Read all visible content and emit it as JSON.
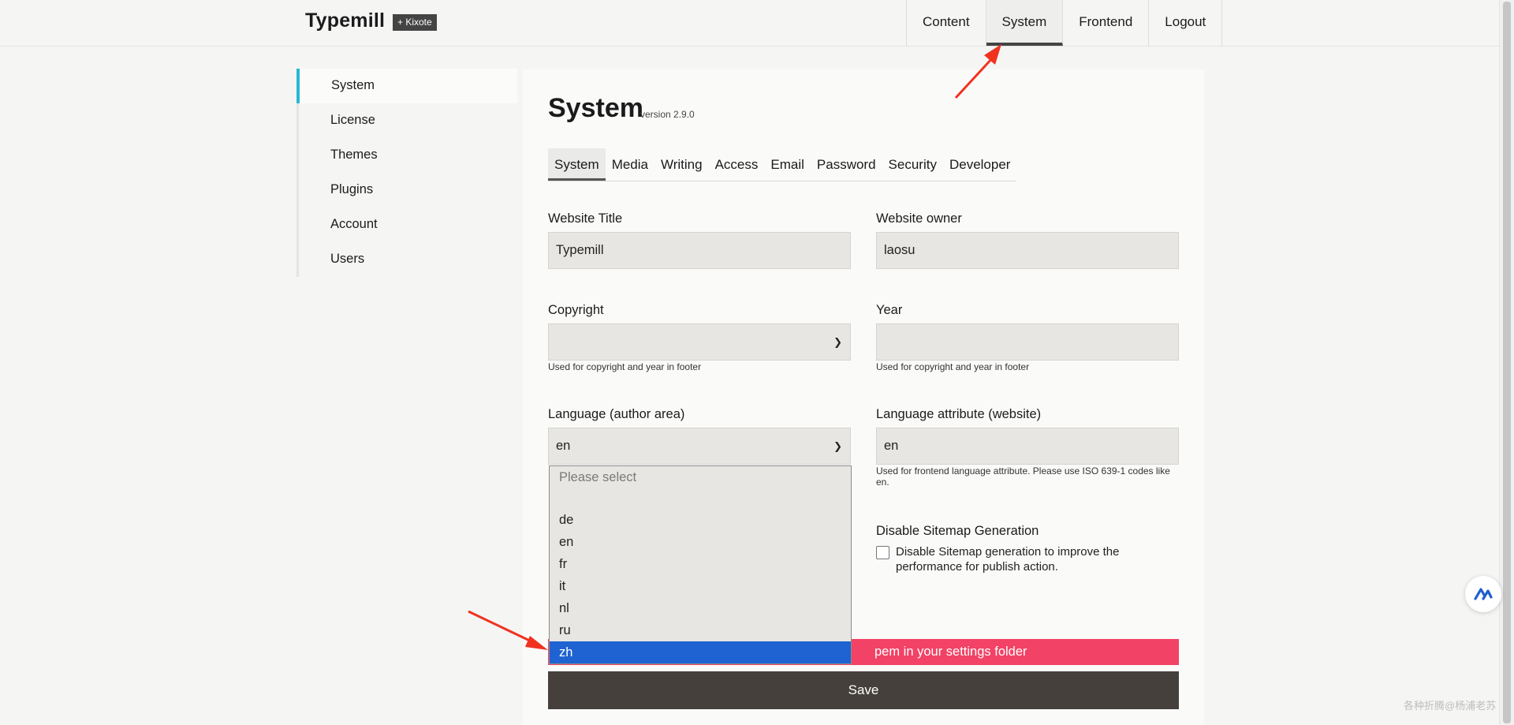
{
  "app": {
    "title": "Typemill",
    "badge": "+ Kixote"
  },
  "topnav": [
    {
      "label": "Content",
      "active": false
    },
    {
      "label": "System",
      "active": true
    },
    {
      "label": "Frontend",
      "active": false
    },
    {
      "label": "Logout",
      "active": false
    }
  ],
  "sidebar": [
    {
      "label": "System",
      "active": true
    },
    {
      "label": "License",
      "active": false
    },
    {
      "label": "Themes",
      "active": false
    },
    {
      "label": "Plugins",
      "active": false
    },
    {
      "label": "Account",
      "active": false
    },
    {
      "label": "Users",
      "active": false
    }
  ],
  "page": {
    "title": "System",
    "version": "version 2.9.0"
  },
  "tabs": [
    {
      "label": "System",
      "active": true
    },
    {
      "label": "Media",
      "active": false
    },
    {
      "label": "Writing",
      "active": false
    },
    {
      "label": "Access",
      "active": false
    },
    {
      "label": "Email",
      "active": false
    },
    {
      "label": "Password",
      "active": false
    },
    {
      "label": "Security",
      "active": false
    },
    {
      "label": "Developer",
      "active": false
    }
  ],
  "form": {
    "website_title": {
      "label": "Website Title",
      "value": "Typemill"
    },
    "website_owner": {
      "label": "Website owner",
      "value": "laosu"
    },
    "copyright": {
      "label": "Copyright",
      "value": "",
      "hint": "Used for copyright and year in footer"
    },
    "year": {
      "label": "Year",
      "value": "",
      "hint": "Used for copyright and year in footer"
    },
    "language_author": {
      "label": "Language (author area)",
      "value": "en"
    },
    "language_attr": {
      "label": "Language attribute (website)",
      "value": "en",
      "hint": "Used for frontend language attribute. Please use ISO 639-1 codes like en."
    },
    "sitemap": {
      "label": "Disable Sitemap Generation",
      "checkbox_text": "Disable Sitemap generation to improve the performance for publish action.",
      "checked": false
    }
  },
  "error": {
    "text": "pem in your settings folder"
  },
  "save_label": "Save",
  "language_dropdown": {
    "placeholder": "Please select",
    "options": [
      "de",
      "en",
      "fr",
      "it",
      "nl",
      "ru",
      "zh"
    ],
    "selected": "zh"
  },
  "watermark": "各种折腾@杨浦老苏",
  "colors": {
    "accent": "#26b8d6",
    "error": "#f24265",
    "button": "#45403b",
    "selected": "#1e63d1",
    "arrow": "#f0321f"
  }
}
